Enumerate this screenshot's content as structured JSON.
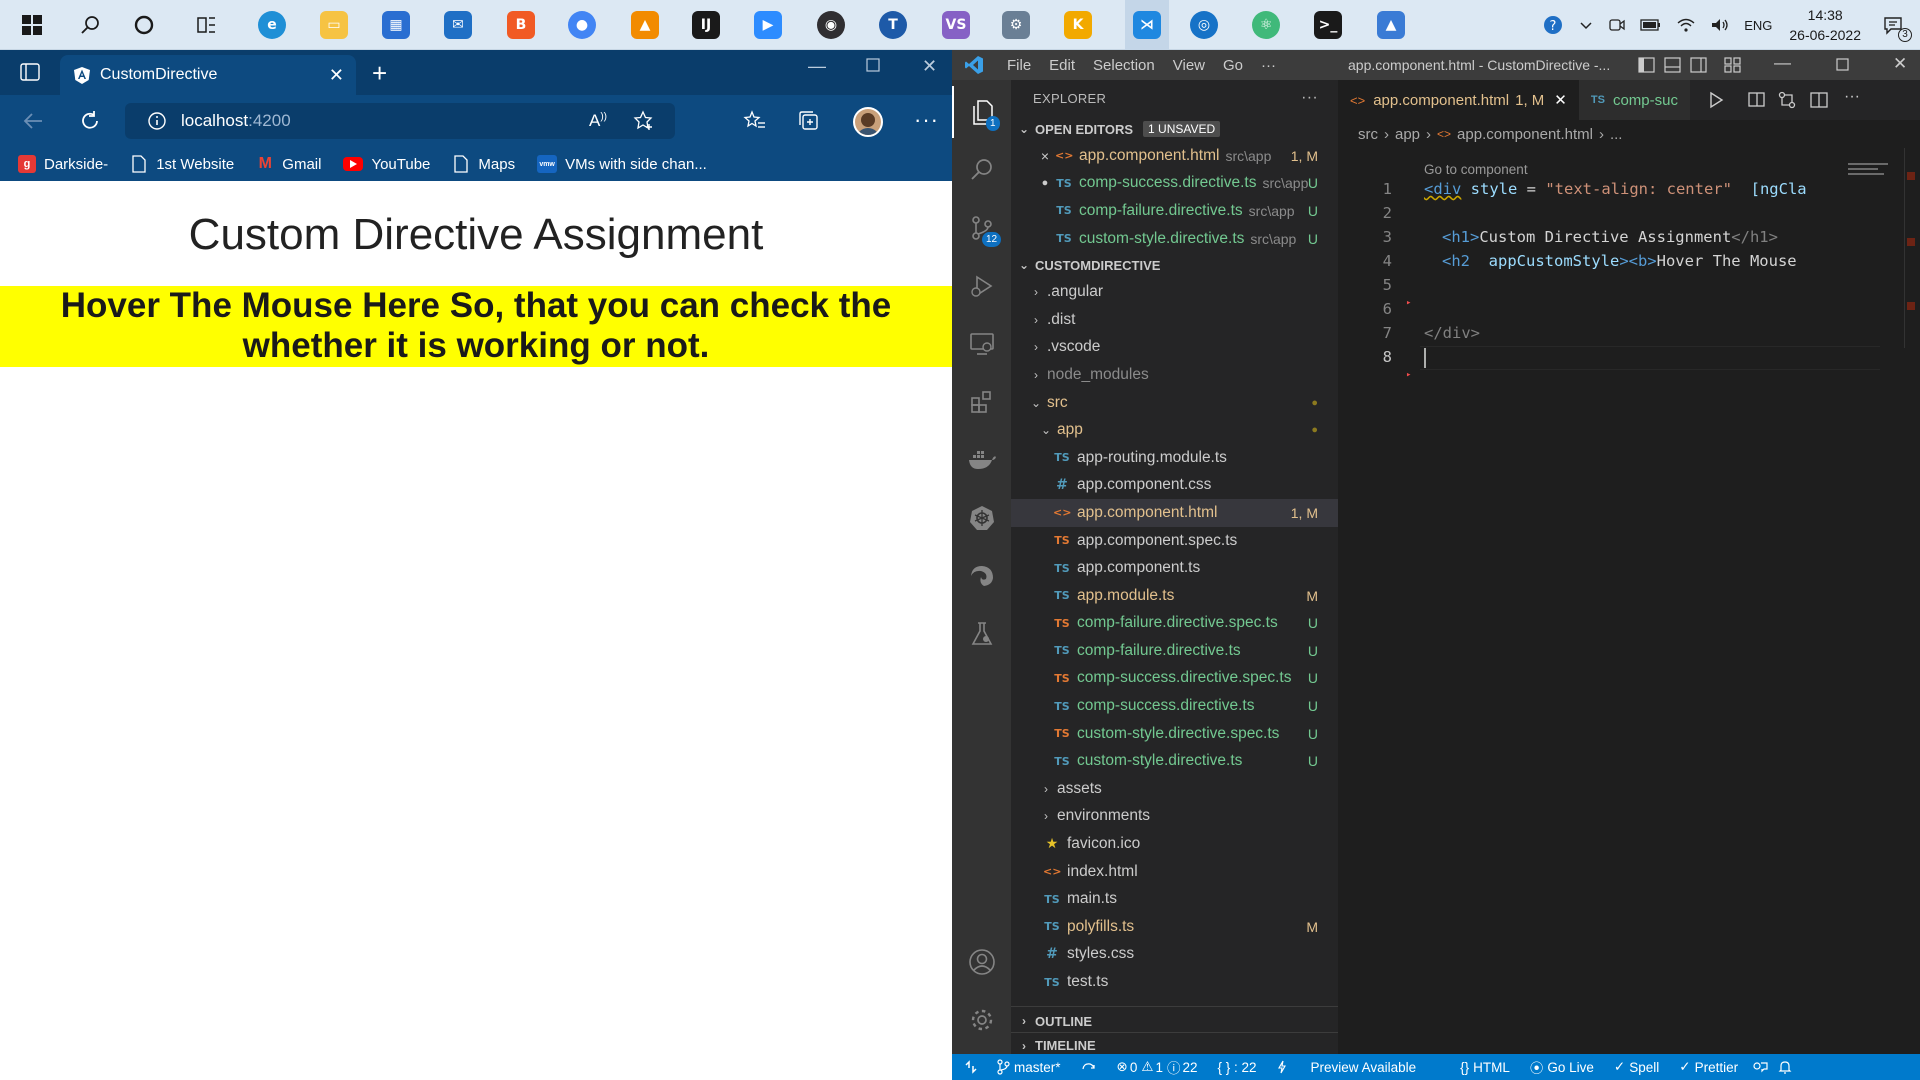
{
  "taskbar": {
    "apps": [
      {
        "name": "start",
        "active": false
      },
      {
        "name": "search",
        "active": false
      },
      {
        "name": "cortana",
        "active": false
      },
      {
        "name": "task-view",
        "active": false
      },
      {
        "name": "edge",
        "active": false
      },
      {
        "name": "file-explorer",
        "active": false
      },
      {
        "name": "store",
        "active": false
      },
      {
        "name": "mail",
        "active": false
      },
      {
        "name": "brave",
        "active": false
      },
      {
        "name": "chrome",
        "active": false
      },
      {
        "name": "vlc",
        "active": false
      },
      {
        "name": "intellij",
        "active": false
      },
      {
        "name": "zoom",
        "active": false
      },
      {
        "name": "obs",
        "active": false
      },
      {
        "name": "t-app",
        "active": false
      },
      {
        "name": "visual-studio",
        "active": false
      },
      {
        "name": "tool-app",
        "active": false
      },
      {
        "name": "kite-app",
        "active": false
      },
      {
        "name": "vscode",
        "active": true
      },
      {
        "name": "record-app",
        "active": false
      },
      {
        "name": "atom",
        "active": false
      },
      {
        "name": "terminal",
        "active": false
      },
      {
        "name": "photos",
        "active": false
      }
    ],
    "tray": {
      "language": "ENG",
      "time": "14:38",
      "date": "26-06-2022",
      "notifications": "3"
    }
  },
  "browser": {
    "tab_title": "CustomDirective",
    "url_host": "localhost",
    "url_port": ":4200",
    "favorites": [
      {
        "label": "Darkside-",
        "icon": "g",
        "color": "#e53935"
      },
      {
        "label": "1st Website",
        "icon": "page",
        "color": "#ffffff"
      },
      {
        "label": "Gmail",
        "icon": "M",
        "color": "#ea4335"
      },
      {
        "label": "YouTube",
        "icon": "play",
        "color": "#ff0000"
      },
      {
        "label": "Maps",
        "icon": "page",
        "color": "#ffffff"
      },
      {
        "label": "VMs with side chan...",
        "icon": "vmw",
        "color": "#1565c0"
      }
    ],
    "page": {
      "heading": "Custom Directive Assignment",
      "hover_line1": "Hover The Mouse Here So, that you can check the",
      "hover_line2": "whether it is working or not."
    }
  },
  "vscode": {
    "menu": [
      "File",
      "Edit",
      "Selection",
      "View",
      "Go",
      "···"
    ],
    "window_title": "app.component.html - CustomDirective -...",
    "activity_badges": {
      "explorer": "1",
      "source_control": "12"
    },
    "explorer_title": "EXPLORER",
    "open_editors_label": "OPEN EDITORS",
    "unsaved_badge": "1 UNSAVED",
    "open_editors": [
      {
        "lead": "×",
        "icon": "<>",
        "name": "app.component.html",
        "path": "src\\app",
        "status": "1, M",
        "kind": "mod"
      },
      {
        "lead": "●",
        "icon": "TS",
        "name": "comp-success.directive.ts",
        "path": "src\\app",
        "status": "U",
        "kind": "unt"
      },
      {
        "lead": "",
        "icon": "TS",
        "name": "comp-failure.directive.ts",
        "path": "src\\app",
        "status": "U",
        "kind": "unt"
      },
      {
        "lead": "",
        "icon": "TS",
        "name": "custom-style.directive.ts",
        "path": "src\\app",
        "status": "U",
        "kind": "unt"
      }
    ],
    "project_label": "CUSTOMDIRECTIVE",
    "tree": [
      {
        "depth": 0,
        "type": "folder",
        "open": false,
        "name": ".angular",
        "status": "",
        "kind": "def"
      },
      {
        "depth": 0,
        "type": "folder",
        "open": false,
        "name": ".dist",
        "status": "",
        "kind": "def"
      },
      {
        "depth": 0,
        "type": "folder",
        "open": false,
        "name": ".vscode",
        "status": "",
        "kind": "def"
      },
      {
        "depth": 0,
        "type": "folder",
        "open": false,
        "name": "node_modules",
        "status": "",
        "kind": "gray"
      },
      {
        "depth": 0,
        "type": "folder",
        "open": true,
        "name": "src",
        "status": "●",
        "kind": "mod"
      },
      {
        "depth": 1,
        "type": "folder",
        "open": true,
        "name": "app",
        "status": "●",
        "kind": "mod"
      },
      {
        "depth": 2,
        "type": "ts",
        "name": "app-routing.module.ts",
        "status": "",
        "kind": "def"
      },
      {
        "depth": 2,
        "type": "css",
        "name": "app.component.css",
        "status": "",
        "kind": "def"
      },
      {
        "depth": 2,
        "type": "html",
        "name": "app.component.html",
        "status": "1, M",
        "kind": "mod",
        "selected": true
      },
      {
        "depth": 2,
        "type": "tsspec",
        "name": "app.component.spec.ts",
        "status": "",
        "kind": "def"
      },
      {
        "depth": 2,
        "type": "ts",
        "name": "app.component.ts",
        "status": "",
        "kind": "def"
      },
      {
        "depth": 2,
        "type": "ts",
        "name": "app.module.ts",
        "status": "M",
        "kind": "mod"
      },
      {
        "depth": 2,
        "type": "tsspec",
        "name": "comp-failure.directive.spec.ts",
        "status": "U",
        "kind": "unt"
      },
      {
        "depth": 2,
        "type": "ts",
        "name": "comp-failure.directive.ts",
        "status": "U",
        "kind": "unt"
      },
      {
        "depth": 2,
        "type": "tsspec",
        "name": "comp-success.directive.spec.ts",
        "status": "U",
        "kind": "unt"
      },
      {
        "depth": 2,
        "type": "ts",
        "name": "comp-success.directive.ts",
        "status": "U",
        "kind": "unt"
      },
      {
        "depth": 2,
        "type": "tsspec",
        "name": "custom-style.directive.spec.ts",
        "status": "U",
        "kind": "unt"
      },
      {
        "depth": 2,
        "type": "ts",
        "name": "custom-style.directive.ts",
        "status": "U",
        "kind": "unt"
      },
      {
        "depth": 1,
        "type": "folder",
        "open": false,
        "name": "assets",
        "status": "",
        "kind": "def"
      },
      {
        "depth": 1,
        "type": "folder",
        "open": false,
        "name": "environments",
        "status": "",
        "kind": "def"
      },
      {
        "depth": 1,
        "type": "star",
        "name": "favicon.ico",
        "status": "",
        "kind": "def"
      },
      {
        "depth": 1,
        "type": "html",
        "name": "index.html",
        "status": "",
        "kind": "def"
      },
      {
        "depth": 1,
        "type": "ts",
        "name": "main.ts",
        "status": "",
        "kind": "def"
      },
      {
        "depth": 1,
        "type": "ts",
        "name": "polyfills.ts",
        "status": "M",
        "kind": "mod"
      },
      {
        "depth": 1,
        "type": "css",
        "name": "styles.css",
        "status": "",
        "kind": "def"
      },
      {
        "depth": 1,
        "type": "ts",
        "name": "test.ts",
        "status": "",
        "kind": "def"
      }
    ],
    "outline_label": "OUTLINE",
    "timeline_label": "TIMELINE",
    "tabs": {
      "active_name": "app.component.html",
      "active_status": "1, M",
      "inactive_name": "comp-suc"
    },
    "breadcrumbs": [
      "src",
      "app",
      "app.component.html",
      "..."
    ],
    "codelens": "Go to component",
    "code_lines": [
      {
        "n": "1"
      },
      {
        "n": "2"
      },
      {
        "n": "3"
      },
      {
        "n": "4"
      },
      {
        "n": "5"
      },
      {
        "n": "6"
      },
      {
        "n": "7"
      },
      {
        "n": "8"
      }
    ],
    "code": {
      "l1_tag": "<div",
      "l1_attr": " style",
      "l1_eq": " = ",
      "l1_str": "\"text-align: center\"",
      "l1_attr2": "  [ngCla",
      "l3_open": "<h1>",
      "l3_text": "Custom Directive Assignment",
      "l3_close": "</h1>",
      "l4_open": "<h2",
      "l4_attr": "  appCustomStyle",
      "l4_b": "><b>",
      "l4_text": "Hover The Mouse",
      "l7_close": "</div>"
    },
    "status": {
      "branch": "master*",
      "errors": "0",
      "warnings": "1",
      "info": "22",
      "braces": "{ } : 22",
      "preview": "Preview Available",
      "language": "HTML",
      "golive": "Go Live",
      "spell": "Spell",
      "prettier": "Prettier"
    }
  }
}
